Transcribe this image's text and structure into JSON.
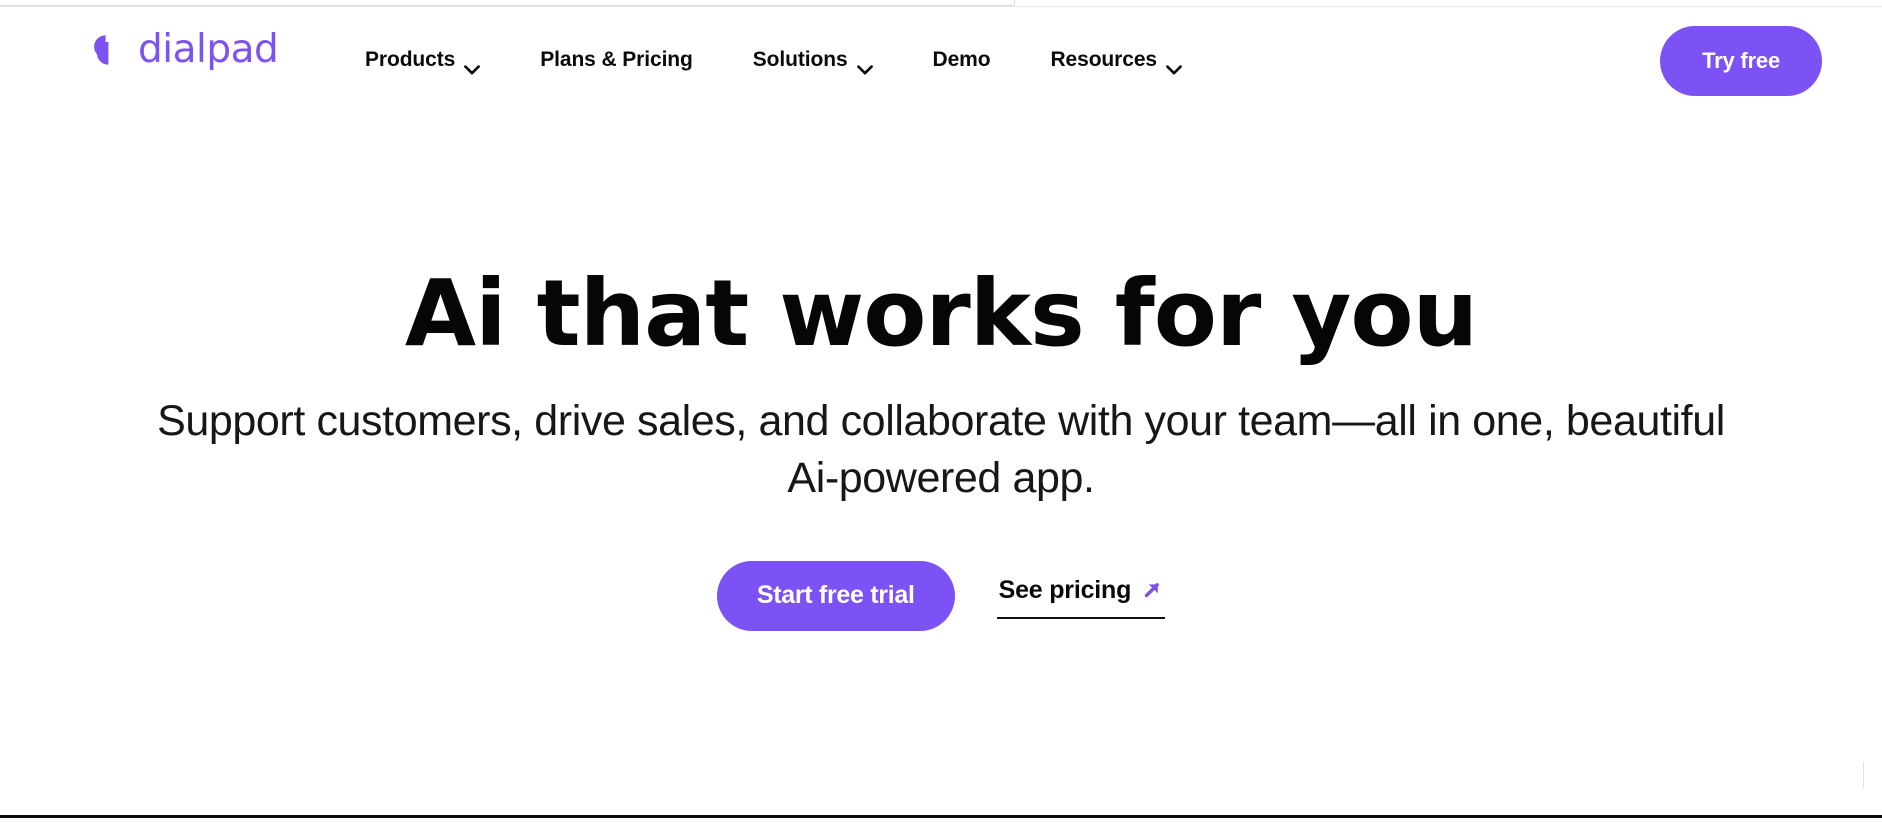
{
  "theme": {
    "accent": "#7C52F5",
    "text": "#0b0b0f",
    "background": "#ffffff"
  },
  "header": {
    "brand": {
      "name": "dialpad",
      "logo_icon": "dialpad-logo-icon"
    },
    "nav": [
      {
        "label": "Products",
        "has_dropdown": true,
        "icon": "chevron-down-icon"
      },
      {
        "label": "Plans & Pricing",
        "has_dropdown": false,
        "icon": ""
      },
      {
        "label": "Solutions",
        "has_dropdown": true,
        "icon": "chevron-down-icon"
      },
      {
        "label": "Demo",
        "has_dropdown": false,
        "icon": ""
      },
      {
        "label": "Resources",
        "has_dropdown": true,
        "icon": "chevron-down-icon"
      }
    ],
    "cta": {
      "label": "Try free"
    }
  },
  "hero": {
    "title": "Ai that works for you",
    "subtitle": "Support customers, drive sales, and collaborate with your team—all in one, beautiful Ai-powered app.",
    "primary_cta": {
      "label": "Start free trial"
    },
    "secondary_cta": {
      "label": "See pricing",
      "icon": "arrow-up-right-icon"
    }
  }
}
